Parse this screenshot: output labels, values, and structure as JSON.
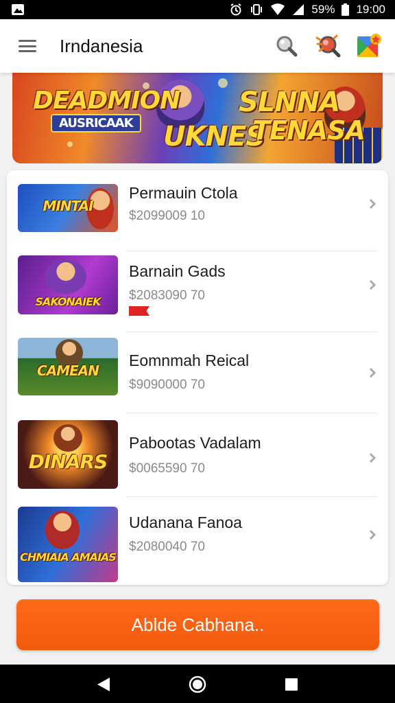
{
  "status_bar": {
    "battery": "59%",
    "time": "19:00"
  },
  "app_bar": {
    "title": "Irndanesia",
    "icons": [
      "menu-icon",
      "search-icon",
      "search-promo-icon",
      "play-store-icon"
    ]
  },
  "banner": {
    "text_1": "DEADMION",
    "text_2": "AUSRICAAK",
    "text_3": "UKNES",
    "text_4": "SLNNA",
    "text_5": "TENASA"
  },
  "games": [
    {
      "thumb_text": "MINTAI",
      "title": "Permauin Ctola",
      "price": "$2099009 10",
      "colors": [
        "#1f4fbf",
        "#e5541e"
      ]
    },
    {
      "thumb_text": "SAKONAIEK",
      "title": "Barnain Gads",
      "price": "$2083090 70",
      "colors": [
        "#5b1f8c",
        "#b03bd0"
      ],
      "badge": ""
    },
    {
      "thumb_text": "CAMEAN",
      "title": "Eomnmah Reical",
      "price": "$9090000 70",
      "colors": [
        "#2b6b2b",
        "#c9a043"
      ]
    },
    {
      "thumb_text": "DINARS",
      "title": "Pabootas Vadalam",
      "price": "$0065590 70",
      "colors": [
        "#4b1a14",
        "#f08a2a"
      ]
    },
    {
      "thumb_text": "CHMIAIA AMAIAS",
      "title": "Udanana Fanoa",
      "price": "$2080040 70",
      "colors": [
        "#1b3b8f",
        "#c33a8a"
      ]
    }
  ],
  "action_button": {
    "label": "Ablde Cabhana.."
  },
  "nav_bar": {
    "icons": [
      "back-icon",
      "home-icon",
      "recents-icon"
    ]
  }
}
